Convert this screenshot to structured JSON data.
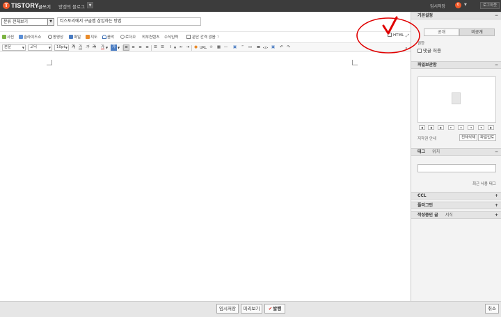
{
  "topbar": {
    "logo_letter": "T",
    "brand": "TISTORY",
    "brand_sub": "글쓰기",
    "blog_name": "양갱의 블로그",
    "autosave_label": "임시저장",
    "autosave_count": "0",
    "logout_label": "로그아웃"
  },
  "header": {
    "category_value": "분류 전체보기",
    "title_value": "티스토리에서 구글맵 삽입하는 방법"
  },
  "toolbar1": {
    "photo": "사진",
    "slideshow": "슬라이드쇼",
    "video": "동영상",
    "file": "파일",
    "map": "지도",
    "music": "음악",
    "location": "로더오",
    "external": "외부컨텐츠",
    "formula": "수식입력",
    "paragraph_spacing": "문단 간격 없음",
    "html_toggle": "HTML"
  },
  "toolbar2": {
    "style_value": "본문",
    "font_value": "고딕",
    "size_value": "10pt",
    "url_label": "URL"
  },
  "sidebar": {
    "basic_settings": "기본설정",
    "public_label": "공개",
    "private_label": "비공개",
    "permission_label": "권한",
    "comment_allow": "댓글 허용",
    "attachments": "파일보관함",
    "attach_info": "저작권 안내",
    "delete_all": "전체삭제",
    "file_upload": "파일업로",
    "tag_label": "태그",
    "location_label": "위치",
    "recent_tags": "최근 사용 태그",
    "ccl_label": "CCL",
    "plugin_label": "플러그인",
    "template_label": "작성중인 글",
    "format_label": "서식"
  },
  "bottombar": {
    "autosave_button": "임시저장",
    "preview_button": "미리보기",
    "publish_button": "발행",
    "cancel_button": "취소"
  },
  "colors": {
    "topbar_bg": "#3c3c3c",
    "accent": "#f25a29",
    "annotation": "#e00000"
  }
}
